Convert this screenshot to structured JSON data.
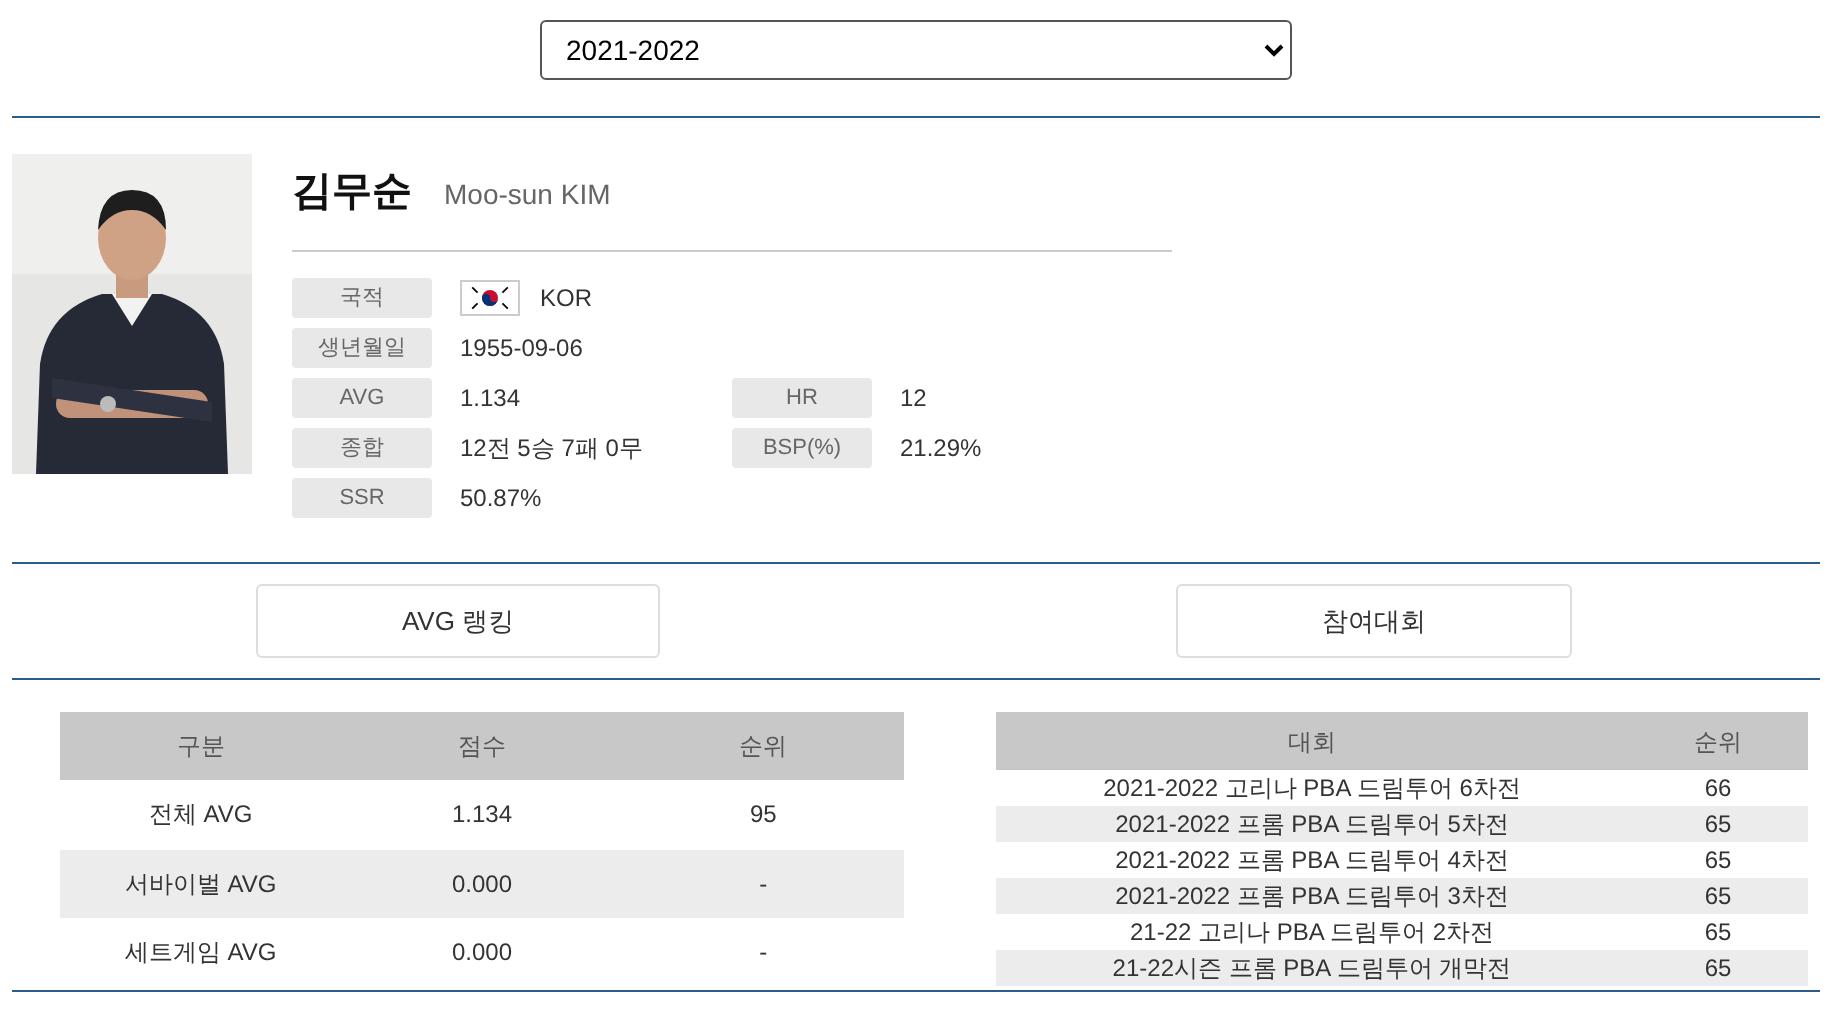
{
  "season_select": {
    "value": "2021-2022"
  },
  "player": {
    "name_ko": "김무순",
    "name_en": "Moo-sun KIM",
    "info": [
      {
        "label": "국적",
        "value": "KOR",
        "flag": true
      },
      {
        "label": "생년월일",
        "value": "1955-09-06",
        "flag": false
      },
      {
        "label": "AVG",
        "value": "1.134",
        "flag": false,
        "label_2": "HR",
        "value_2": "12"
      },
      {
        "label": "종합",
        "value": "12전 5승 7패 0무",
        "flag": false,
        "label_2": "BSP(%)",
        "value_2": "21.29%"
      },
      {
        "label": "SSR",
        "value": "50.87%",
        "flag": false
      }
    ]
  },
  "buttons": [
    "AVG 랭킹",
    "참여대회"
  ],
  "avg_table": {
    "columns": [
      "구분",
      "점수",
      "순위"
    ],
    "rows": [
      [
        "전체 AVG",
        "1.134",
        "95"
      ],
      [
        "서바이벌 AVG",
        "0.000",
        "-"
      ],
      [
        "세트게임 AVG",
        "0.000",
        "-"
      ]
    ]
  },
  "tournament_table": {
    "columns": [
      "대회",
      "순위"
    ],
    "rows": [
      [
        "2021-2022 고리나 PBA 드림투어 6차전",
        "66"
      ],
      [
        "2021-2022 프롬 PBA 드림투어 5차전",
        "65"
      ],
      [
        "2021-2022 프롬 PBA 드림투어 4차전",
        "65"
      ],
      [
        "2021-2022 프롬 PBA 드림투어 3차전",
        "65"
      ],
      [
        "21-22 고리나 PBA 드림투어 2차전",
        "65"
      ],
      [
        "21-22시즌 프롬 PBA 드림투어 개막전",
        "65"
      ]
    ]
  }
}
